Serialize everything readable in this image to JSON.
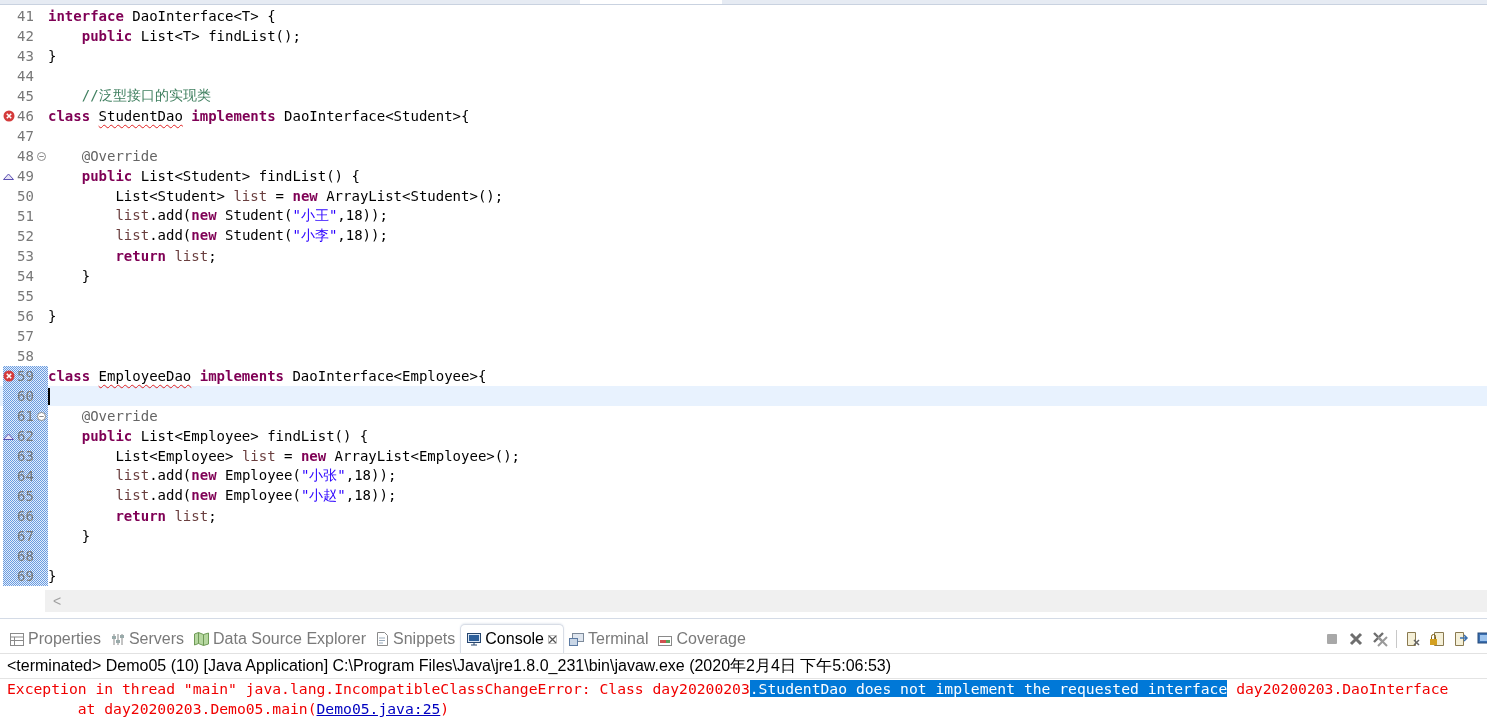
{
  "editor": {
    "lines": [
      {
        "number": "41",
        "in_range": false,
        "current": false,
        "tokens": [
          {
            "kind": "keyword",
            "text": "interface"
          },
          {
            "kind": "text",
            "text": " DaoInterface<T> {"
          }
        ]
      },
      {
        "number": "42",
        "in_range": false,
        "current": false,
        "tokens": [
          {
            "kind": "keyword",
            "text": "    public"
          },
          {
            "kind": "text",
            "text": " List<T> findList();"
          }
        ]
      },
      {
        "number": "43",
        "in_range": false,
        "current": false,
        "tokens": [
          {
            "kind": "text",
            "text": "}"
          }
        ]
      },
      {
        "number": "44",
        "in_range": false,
        "current": false
      },
      {
        "number": "45",
        "in_range": false,
        "current": false,
        "tokens": [
          {
            "kind": "comment",
            "text": "    //泛型接口的实现类"
          }
        ]
      },
      {
        "number": "46",
        "marker": {
          "kind": "error"
        },
        "in_range": false,
        "current": false,
        "tokens": [
          {
            "kind": "keyword",
            "text": "class "
          },
          {
            "kind": "error",
            "text": "StudentDao"
          },
          {
            "kind": "keyword",
            "text": " implements"
          },
          {
            "kind": "text",
            "text": " DaoInterface<Student>{"
          }
        ]
      },
      {
        "number": "47",
        "in_range": false,
        "current": false
      },
      {
        "number": "48",
        "marker": {
          "kind": "fold"
        },
        "in_range": false,
        "current": false,
        "tokens": [
          {
            "kind": "annotation",
            "text": "    @Override"
          }
        ]
      },
      {
        "number": "49",
        "marker": {
          "kind": "override"
        },
        "in_range": false,
        "current": false,
        "tokens": [
          {
            "kind": "keyword",
            "text": "    public"
          },
          {
            "kind": "text",
            "text": " List<Student> findList() {"
          }
        ]
      },
      {
        "number": "50",
        "in_range": false,
        "current": false,
        "tokens": [
          {
            "kind": "text",
            "text": "        List<Student> "
          },
          {
            "kind": "variable",
            "text": "list"
          },
          {
            "kind": "text",
            "text": " = "
          },
          {
            "kind": "keyword",
            "text": "new"
          },
          {
            "kind": "text",
            "text": " ArrayList<Student>();"
          }
        ]
      },
      {
        "number": "51",
        "in_range": false,
        "current": false,
        "tokens": [
          {
            "kind": "variable",
            "text": "        list"
          },
          {
            "kind": "text",
            "text": ".add("
          },
          {
            "kind": "keyword",
            "text": "new"
          },
          {
            "kind": "text",
            "text": " Student("
          },
          {
            "kind": "string",
            "text": "\"小王\""
          },
          {
            "kind": "text",
            "text": ",18));"
          }
        ]
      },
      {
        "number": "52",
        "in_range": false,
        "current": false,
        "tokens": [
          {
            "kind": "variable",
            "text": "        list"
          },
          {
            "kind": "text",
            "text": ".add("
          },
          {
            "kind": "keyword",
            "text": "new"
          },
          {
            "kind": "text",
            "text": " Student("
          },
          {
            "kind": "string",
            "text": "\"小李\""
          },
          {
            "kind": "text",
            "text": ",18));"
          }
        ]
      },
      {
        "number": "53",
        "in_range": false,
        "current": false,
        "tokens": [
          {
            "kind": "keyword",
            "text": "        return "
          },
          {
            "kind": "variable",
            "text": "list"
          },
          {
            "kind": "text",
            "text": ";"
          }
        ]
      },
      {
        "number": "54",
        "in_range": false,
        "current": false,
        "tokens": [
          {
            "kind": "text",
            "text": "    }"
          }
        ]
      },
      {
        "number": "55",
        "in_range": false,
        "current": false
      },
      {
        "number": "56",
        "in_range": false,
        "current": false,
        "tokens": [
          {
            "kind": "text",
            "text": "}"
          }
        ]
      },
      {
        "number": "57",
        "in_range": false,
        "current": false
      },
      {
        "number": "58",
        "in_range": false,
        "current": false
      },
      {
        "number": "59",
        "marker": {
          "kind": "error"
        },
        "in_range": true,
        "current": false,
        "tokens": [
          {
            "kind": "keyword",
            "text": "class "
          },
          {
            "kind": "error",
            "text": "EmployeeDao"
          },
          {
            "kind": "keyword",
            "text": " implements"
          },
          {
            "kind": "text",
            "text": " DaoInterface<Employee>{"
          }
        ]
      },
      {
        "number": "60",
        "in_range": true,
        "current": true
      },
      {
        "number": "61",
        "marker": {
          "kind": "fold"
        },
        "in_range": true,
        "current": false,
        "tokens": [
          {
            "kind": "annotation",
            "text": "    @Override"
          }
        ]
      },
      {
        "number": "62",
        "marker": {
          "kind": "override"
        },
        "in_range": true,
        "current": false,
        "tokens": [
          {
            "kind": "keyword",
            "text": "    public"
          },
          {
            "kind": "text",
            "text": " List<Employee> findList() {"
          }
        ]
      },
      {
        "number": "63",
        "in_range": true,
        "current": false,
        "tokens": [
          {
            "kind": "text",
            "text": "        List<Employee> "
          },
          {
            "kind": "variable",
            "text": "list"
          },
          {
            "kind": "text",
            "text": " = "
          },
          {
            "kind": "keyword",
            "text": "new"
          },
          {
            "kind": "text",
            "text": " ArrayList<Employee>();"
          }
        ]
      },
      {
        "number": "64",
        "in_range": true,
        "current": false,
        "tokens": [
          {
            "kind": "variable",
            "text": "        list"
          },
          {
            "kind": "text",
            "text": ".add("
          },
          {
            "kind": "keyword",
            "text": "new"
          },
          {
            "kind": "text",
            "text": " Employee("
          },
          {
            "kind": "string",
            "text": "\"小张\""
          },
          {
            "kind": "text",
            "text": ",18));"
          }
        ]
      },
      {
        "number": "65",
        "in_range": true,
        "current": false,
        "tokens": [
          {
            "kind": "variable",
            "text": "        list"
          },
          {
            "kind": "text",
            "text": ".add("
          },
          {
            "kind": "keyword",
            "text": "new"
          },
          {
            "kind": "text",
            "text": " Employee("
          },
          {
            "kind": "string",
            "text": "\"小赵\""
          },
          {
            "kind": "text",
            "text": ",18));"
          }
        ]
      },
      {
        "number": "66",
        "in_range": true,
        "current": false,
        "tokens": [
          {
            "kind": "keyword",
            "text": "        return "
          },
          {
            "kind": "variable",
            "text": "list"
          },
          {
            "kind": "text",
            "text": ";"
          }
        ]
      },
      {
        "number": "67",
        "in_range": true,
        "current": false,
        "tokens": [
          {
            "kind": "text",
            "text": "    }"
          }
        ]
      },
      {
        "number": "68",
        "in_range": true,
        "current": false
      },
      {
        "number": "69",
        "in_range": true,
        "current": false,
        "tokens": [
          {
            "kind": "text",
            "text": "}"
          }
        ]
      }
    ],
    "scroll_left": "<"
  },
  "panel": {
    "tabs": [
      {
        "label": "Properties",
        "selected": false
      },
      {
        "label": "Servers",
        "selected": false
      },
      {
        "label": "Data Source Explorer",
        "selected": false
      },
      {
        "label": "Snippets",
        "selected": false
      },
      {
        "label": "Console",
        "selected": true
      },
      {
        "label": "Terminal",
        "selected": false
      },
      {
        "label": "Coverage",
        "selected": false
      }
    ],
    "console": {
      "header": "<terminated> Demo05 (10) [Java Application] C:\\Program Files\\Java\\jre1.8.0_231\\bin\\javaw.exe (2020年2月4日 下午5:06:53)",
      "output": [
        {
          "segments": [
            {
              "kind": "text",
              "selected": false,
              "text": "Exception in thread \"main\" java.lang.IncompatibleClassChangeError: Class day20200203"
            },
            {
              "kind": "text",
              "selected": true,
              "text": ".StudentDao does not implement the requested interface"
            },
            {
              "kind": "text",
              "selected": false,
              "text": " day20200203.DaoInterface"
            }
          ]
        },
        {
          "segments": [
            {
              "kind": "text",
              "selected": false,
              "text": "\tat day20200203.Demo05.main("
            },
            {
              "kind": "link",
              "selected": false,
              "text": "Demo05.java:25"
            },
            {
              "kind": "text",
              "selected": false,
              "text": ")"
            }
          ]
        }
      ]
    }
  }
}
